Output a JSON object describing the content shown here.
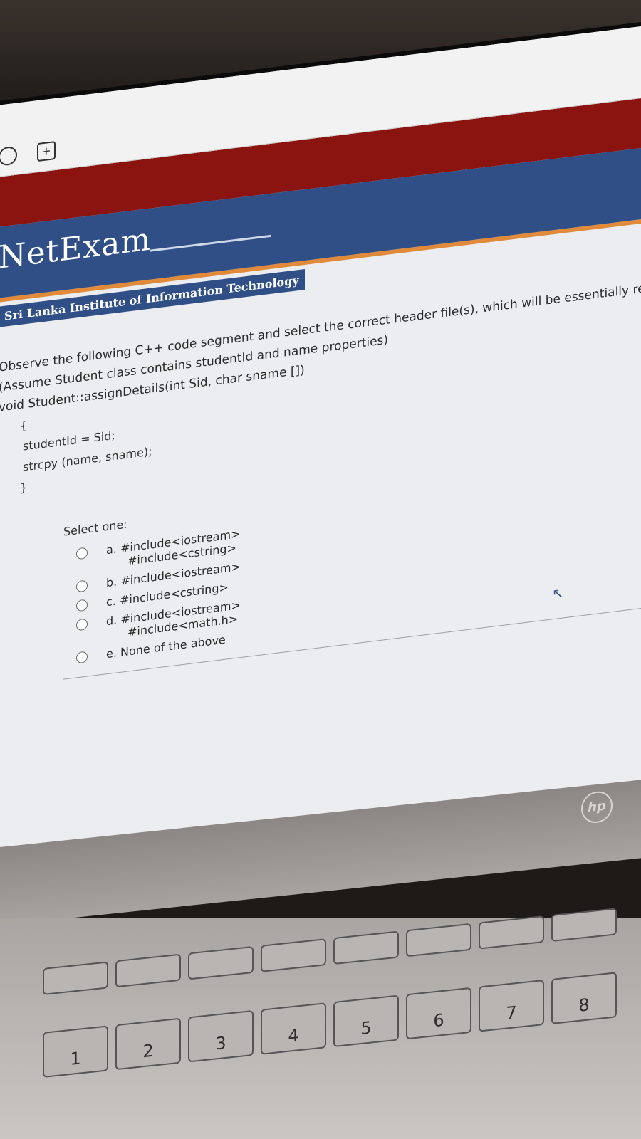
{
  "toolbar": {
    "icons": [
      "refresh-icon",
      "new-tab-icon"
    ],
    "plus_glyph": "+"
  },
  "brand": {
    "logo_text": "NetExam",
    "institute": "Sri Lanka Institute of Information Technology"
  },
  "question": {
    "line1": "Observe the following C++ code segment and select the correct header file(s), which will be essentially requi",
    "line2": "(Assume Student class contains studentId and name properties)",
    "code": {
      "signature": "void Student::assignDetails(int Sid, char sname [])",
      "open_brace": "{",
      "stmt1": "studentId = Sid;",
      "stmt2": "strcpy (name, sname);",
      "close_brace": "}"
    }
  },
  "answer": {
    "prompt": "Select one:",
    "options": [
      {
        "label": "a. #include<iostream>",
        "sub": "#include<cstring>"
      },
      {
        "label": "b. #include<iostream>",
        "sub": ""
      },
      {
        "label": "c. #include<cstring>",
        "sub": ""
      },
      {
        "label": "d. #include<iostream>",
        "sub": "#include<math.h>"
      },
      {
        "label": "e. None of the above",
        "sub": ""
      }
    ]
  },
  "laptop": {
    "brand_mark": "hp",
    "fkeys": [
      "",
      "",
      "",
      "",
      "",
      "",
      "",
      ""
    ],
    "number_keys": [
      "1",
      "2",
      "3",
      "4",
      "5",
      "6",
      "7",
      "8"
    ]
  },
  "colors": {
    "header_blue": "#2f4f86",
    "red_band": "#8b1410",
    "orange_line": "#e08a3a",
    "screen_bg": "#ecedf0"
  }
}
